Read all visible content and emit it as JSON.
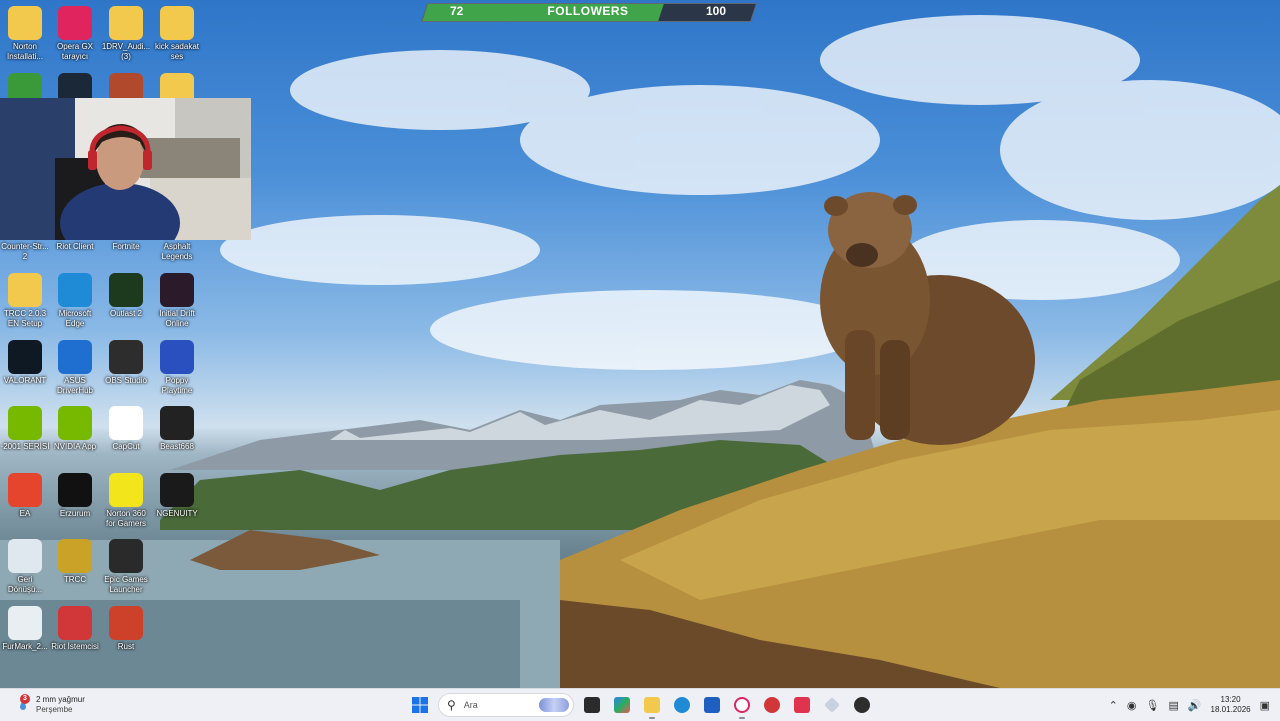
{
  "followers": {
    "current": "72",
    "label": "FOLLOWERS",
    "goal": "100",
    "progress_fraction": 0.72,
    "fill_color": "#3fa44a"
  },
  "desktop_icons": [
    {
      "label": "Norton Installati...",
      "icon": "norton-folder-icon",
      "color": "#f2c94c"
    },
    {
      "label": "Opera GX tarayıcı",
      "icon": "opera-gx-icon",
      "color": "#e0245e"
    },
    {
      "label": "1DRV_Audi... (3)",
      "icon": "folder-icon",
      "color": "#f2c94c"
    },
    {
      "label": "kick sadakat ses",
      "icon": "folder-icon",
      "color": "#f2c94c"
    },
    {
      "label": "",
      "icon": "xbox-icon",
      "color": "#3a9a3a"
    },
    {
      "label": "",
      "icon": "steam-icon",
      "color": "#1b2838"
    },
    {
      "label": "",
      "icon": "game-icon",
      "color": "#b14a2c"
    },
    {
      "label": "",
      "icon": "folder-icon",
      "color": "#f2c94c"
    },
    {
      "label": "Counter-Str... 2",
      "icon": "cs2-icon",
      "color": "#d9a022"
    },
    {
      "label": "Riot Client",
      "icon": "riot-client-icon",
      "color": "#d13639"
    },
    {
      "label": "Fortnite",
      "icon": "fortnite-icon",
      "color": "#3c6fd6"
    },
    {
      "label": "Asphalt Legends",
      "icon": "asphalt-icon",
      "color": "#333"
    },
    {
      "label": "TRCC 2.0.3 EN Setup",
      "icon": "folder-icon",
      "color": "#f2c94c"
    },
    {
      "label": "Microsoft Edge",
      "icon": "edge-icon",
      "color": "#1f8ad6"
    },
    {
      "label": "Outlast 2",
      "icon": "outlast-icon",
      "color": "#1e3a1e"
    },
    {
      "label": "Initial Drift Online",
      "icon": "initial-drift-icon",
      "color": "#2a1a2a"
    },
    {
      "label": "VALORANT",
      "icon": "valorant-icon",
      "color": "#0f1923"
    },
    {
      "label": "ASUS DriverHub",
      "icon": "asus-driverhub-icon",
      "color": "#1f6fd0"
    },
    {
      "label": "OBS Studio",
      "icon": "obs-icon",
      "color": "#2d2d2d"
    },
    {
      "label": "Poppy Playtime",
      "icon": "poppy-playtime-icon",
      "color": "#2a4fbf"
    },
    {
      "label": "-2001 SERİSİ",
      "icon": "nvidia-icon",
      "color": "#76b900"
    },
    {
      "label": "NVIDIA App",
      "icon": "nvidia-icon",
      "color": "#76b900"
    },
    {
      "label": "CapCut",
      "icon": "capcut-icon",
      "color": "#ffffff"
    },
    {
      "label": "Beast668",
      "icon": "beast-icon",
      "color": "#222"
    },
    {
      "label": "EA",
      "icon": "ea-icon",
      "color": "#e4452c"
    },
    {
      "label": "Erzurum",
      "icon": "erzurum-icon",
      "color": "#111"
    },
    {
      "label": "Norton 360 for Gamers",
      "icon": "norton-icon",
      "color": "#f2e51c"
    },
    {
      "label": "NGENUITY",
      "icon": "ngenuity-icon",
      "color": "#1a1a1a"
    },
    {
      "label": "Geri Dönüşü...",
      "icon": "recycle-bin-icon",
      "color": "#dfe8ee"
    },
    {
      "label": "TRCC",
      "icon": "trcc-icon",
      "color": "#c9a227"
    },
    {
      "label": "Epic Games Launcher",
      "icon": "epic-games-icon",
      "color": "#2a2a2a"
    },
    {
      "label": "",
      "icon": "blank-icon",
      "color": "transparent"
    },
    {
      "label": "FurMark_2...",
      "icon": "furmark-icon",
      "color": "#e9eef2"
    },
    {
      "label": "Riot İstemcisi",
      "icon": "riot-client-icon",
      "color": "#d13639"
    },
    {
      "label": "Rust",
      "icon": "rust-icon",
      "color": "#cd412b"
    }
  ],
  "taskbar": {
    "weather": {
      "badge": "3",
      "line1": "2 mm yağmur",
      "line2": "Perşembe"
    },
    "search_placeholder": "Ara",
    "clock": {
      "time": "13:20",
      "date": "18.01.2026"
    }
  }
}
